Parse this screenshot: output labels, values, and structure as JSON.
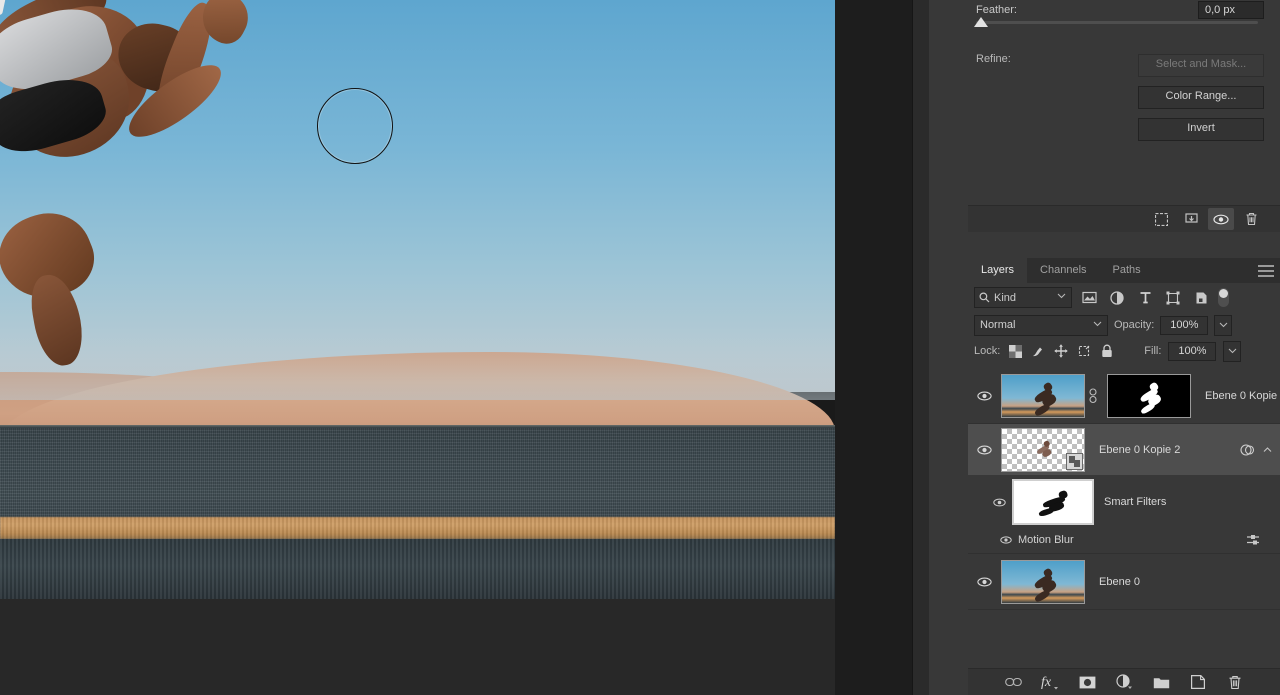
{
  "properties_panel": {
    "feather_label": "Feather:",
    "feather_value": "0,0 px",
    "refine_label": "Refine:",
    "select_and_mask_label": "Select and Mask...",
    "color_range_label": "Color Range...",
    "invert_label": "Invert",
    "footer_icons": [
      {
        "name": "load-selection-icon",
        "active": false
      },
      {
        "name": "add-mask-icon",
        "active": false
      },
      {
        "name": "toggle-visibility-icon",
        "active": true
      },
      {
        "name": "delete-icon",
        "active": false
      }
    ]
  },
  "layers_panel": {
    "tabs": [
      {
        "label": "Layers",
        "active": true
      },
      {
        "label": "Channels",
        "active": false
      },
      {
        "label": "Paths",
        "active": false
      }
    ],
    "panel_menu_icon": "hamburger-icon",
    "filter": {
      "kind_label": "Kind",
      "search_icon": "search-icon",
      "icons": [
        "pixel-filter-icon",
        "adjustment-filter-icon",
        "type-filter-icon",
        "shape-filter-icon",
        "smart-object-filter-icon"
      ],
      "toggle_icon": "filter-toggle-switch"
    },
    "blend": {
      "mode": "Normal",
      "opacity_label": "Opacity:",
      "opacity_value": "100%"
    },
    "lock": {
      "label": "Lock:",
      "icons": [
        "lock-transparency-icon",
        "lock-image-icon",
        "lock-position-icon",
        "lock-artboard-icon",
        "lock-all-icon"
      ],
      "fill_label": "Fill:",
      "fill_value": "100%"
    },
    "layers": [
      {
        "name": "Ebene 0 Kopie",
        "visible": true,
        "selected": false,
        "thumb_type": "photo",
        "has_link": true,
        "has_mask": true,
        "mask_type": "black-mask"
      },
      {
        "name": "Ebene 0 Kopie 2",
        "visible": true,
        "selected": true,
        "thumb_type": "transparent",
        "smart_object": true,
        "right_icons": [
          "smart-filter-indicator-icon",
          "collapse-chevron-icon"
        ]
      },
      {
        "name": "Smart Filters",
        "visible": true,
        "is_filter_group": true,
        "thumb_type": "white-mask",
        "filters": [
          {
            "name": "Motion Blur",
            "visible": true,
            "settings_icon": "filter-blending-options-icon"
          }
        ]
      },
      {
        "name": "Ebene 0",
        "visible": true,
        "selected": false,
        "thumb_type": "photo"
      }
    ],
    "footer_icons": [
      "link-layers-icon",
      "layer-style-fx-icon",
      "add-layer-mask-icon",
      "new-adjustment-layer-icon",
      "new-group-icon",
      "new-layer-icon",
      "delete-layer-icon"
    ]
  },
  "canvas": {
    "tool_cursor": "brush-circle-cursor",
    "image_description": "sprinter-on-desert-road"
  }
}
